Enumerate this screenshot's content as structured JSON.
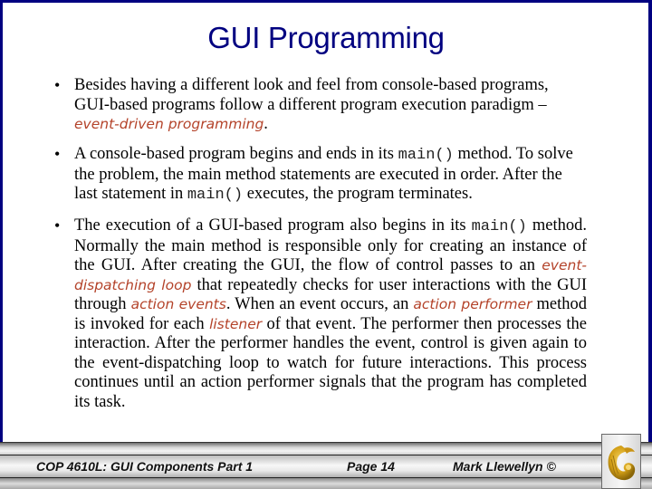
{
  "slide": {
    "title": "GUI Programming",
    "bullets": [
      {
        "segments": [
          {
            "type": "text",
            "value": "Besides having a different look and feel from console-based programs, GUI-based programs follow a different program execution paradigm – "
          },
          {
            "type": "term",
            "value": "event-driven programming"
          },
          {
            "type": "text",
            "value": "."
          }
        ]
      },
      {
        "segments": [
          {
            "type": "text",
            "value": "A console-based program begins and ends in its "
          },
          {
            "type": "code",
            "value": "main()"
          },
          {
            "type": "text",
            "value": " method.  To solve the problem, the main method statements are executed in order.  After the last statement in "
          },
          {
            "type": "code",
            "value": "main()"
          },
          {
            "type": "text",
            "value": " executes, the program terminates."
          }
        ]
      },
      {
        "segments": [
          {
            "type": "text",
            "value": "The execution of a GUI-based program also begins in its "
          },
          {
            "type": "code",
            "value": "main()"
          },
          {
            "type": "text",
            "value": " method.  Normally the main method is responsible only for creating an instance of the GUI.  After creating the GUI, the flow of control passes to an "
          },
          {
            "type": "term",
            "value": "event-dispatching loop"
          },
          {
            "type": "text",
            "value": " that repeatedly checks for user interactions with the GUI through "
          },
          {
            "type": "term",
            "value": "action events"
          },
          {
            "type": "text",
            "value": ".  When an event occurs, an "
          },
          {
            "type": "term",
            "value": "action performer"
          },
          {
            "type": "text",
            "value": " method is invoked for each "
          },
          {
            "type": "term",
            "value": "listener"
          },
          {
            "type": "text",
            "value": " of that event.  The performer then processes the interaction.  After the performer handles the event, control is given again to the event-dispatching loop to watch for future interactions.  This process continues until an action performer signals that the program has completed its task."
          }
        ]
      }
    ],
    "bullet_glyph": "•"
  },
  "footer": {
    "course": "COP 4610L: GUI Components Part 1",
    "page": "Page 14",
    "author": "Mark Llewellyn ©",
    "logo_icon": "pegasus-logo-icon"
  },
  "colors": {
    "title": "#000080",
    "border": "#000080",
    "term": "#b4432a",
    "logo_gold": "#d4a017"
  }
}
